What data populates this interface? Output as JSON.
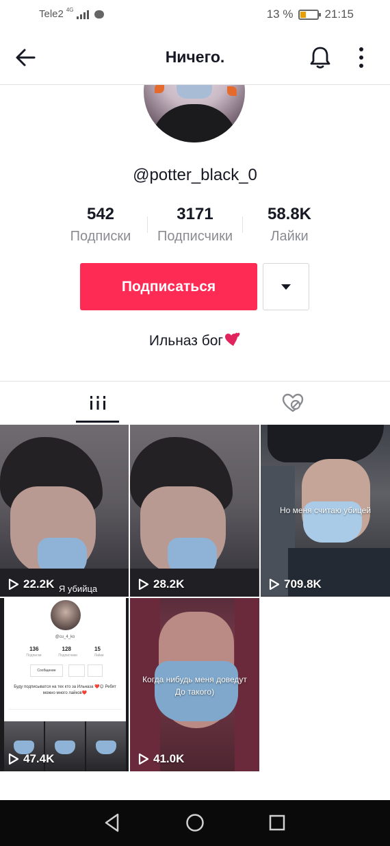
{
  "status_bar": {
    "carrier": "Tele2",
    "network": "4G",
    "battery": "13 %",
    "time": "21:15"
  },
  "header": {
    "title": "Ничего.",
    "icons": [
      "arrow-left-icon",
      "bell-icon",
      "vertical-dots-icon"
    ]
  },
  "profile": {
    "username": "@potter_black_0",
    "stats": [
      {
        "value": "542",
        "label": "Подписки"
      },
      {
        "value": "3171",
        "label": "Подписчики"
      },
      {
        "value": "58.8K",
        "label": "Лайки"
      }
    ],
    "follow_label": "Подписаться",
    "bio": "Ильназ бог",
    "bio_emoji": "two-hearts-icon"
  },
  "tabs": [
    {
      "name": "videos",
      "icon": "grid-icon",
      "active": true
    },
    {
      "name": "liked",
      "icon": "liked-hidden-icon",
      "active": false
    }
  ],
  "videos": [
    {
      "views": "22.2K",
      "overlay": "Я убийца"
    },
    {
      "views": "28.2K",
      "overlay": ""
    },
    {
      "views": "709.8K",
      "overlay": "Но меня считаю убицей"
    },
    {
      "views": "47.4K",
      "overlay": "",
      "embedded_profile": {
        "username": "@cu_4_ko",
        "stats": [
          "136",
          "128",
          "15"
        ],
        "stat_labels": [
          "Подписки",
          "Подписчики",
          "Лайки"
        ],
        "button": "Сообщение",
        "bio": "Буду подписыватся на тех кто за Ильназа ❤️😊 Ребят можно много лайков❤️"
      }
    },
    {
      "views": "41.0K",
      "overlay": "Когда нибудь меня доведут До такого)"
    }
  ],
  "colors": {
    "accent": "#fe2c55",
    "text": "#161823",
    "muted": "#8a8b91"
  }
}
